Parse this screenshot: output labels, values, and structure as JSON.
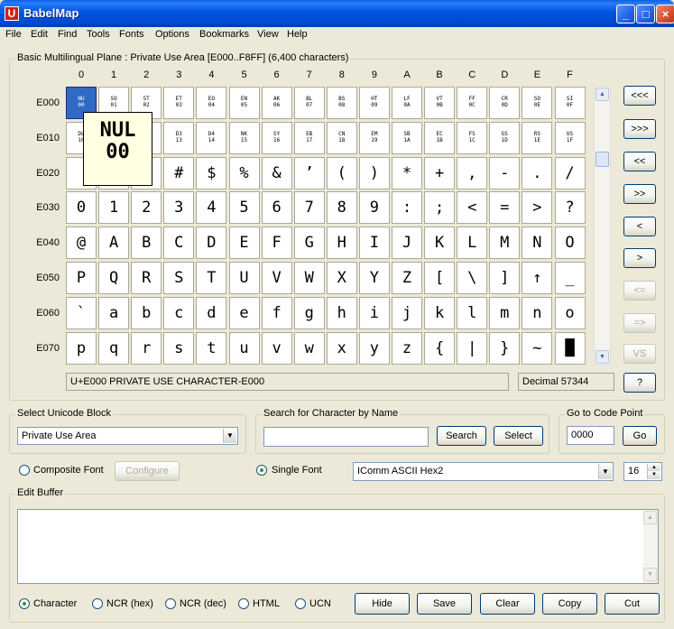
{
  "window": {
    "title": "BabelMap",
    "app_icon": "U"
  },
  "menu": [
    "File",
    "Edit",
    "Find",
    "Tools",
    "Fonts",
    "Options",
    "Bookmarks",
    "View",
    "Help"
  ],
  "grid": {
    "heading": "Basic Multilingual Plane : Private Use Area [E000..F8FF] (6,400 characters)",
    "columns": [
      "0",
      "1",
      "2",
      "3",
      "4",
      "5",
      "6",
      "7",
      "8",
      "9",
      "A",
      "B",
      "C",
      "D",
      "E",
      "F"
    ],
    "rows": [
      {
        "label": "E000",
        "small": true,
        "cells": [
          [
            "NU",
            "00"
          ],
          [
            "SO",
            "01"
          ],
          [
            "ST",
            "02"
          ],
          [
            "ET",
            "03"
          ],
          [
            "EO",
            "04"
          ],
          [
            "EN",
            "05"
          ],
          [
            "AK",
            "06"
          ],
          [
            "BL",
            "07"
          ],
          [
            "BS",
            "08"
          ],
          [
            "HT",
            "09"
          ],
          [
            "LF",
            "0A"
          ],
          [
            "VT",
            "0B"
          ],
          [
            "FF",
            "0C"
          ],
          [
            "CR",
            "0D"
          ],
          [
            "SO",
            "0E"
          ],
          [
            "SI",
            "0F"
          ]
        ]
      },
      {
        "label": "E010",
        "small": true,
        "cells": [
          [
            "DL",
            "10"
          ],
          [
            "D1",
            "11"
          ],
          [
            "D2",
            "12"
          ],
          [
            "D3",
            "13"
          ],
          [
            "D4",
            "14"
          ],
          [
            "NK",
            "15"
          ],
          [
            "SY",
            "16"
          ],
          [
            "EB",
            "17"
          ],
          [
            "CN",
            "18"
          ],
          [
            "EM",
            "19"
          ],
          [
            "SB",
            "1A"
          ],
          [
            "EC",
            "1B"
          ],
          [
            "FS",
            "1C"
          ],
          [
            "GS",
            "1D"
          ],
          [
            "RS",
            "1E"
          ],
          [
            "US",
            "1F"
          ]
        ]
      },
      {
        "label": "E020",
        "small": false,
        "cells": [
          "",
          "!",
          "\"",
          "#",
          "$",
          "%",
          "&",
          "’",
          "(",
          ")",
          "*",
          "+",
          ",",
          "-",
          ".",
          "/"
        ]
      },
      {
        "label": "E030",
        "small": false,
        "cells": [
          "0",
          "1",
          "2",
          "3",
          "4",
          "5",
          "6",
          "7",
          "8",
          "9",
          ":",
          ";",
          "<",
          "=",
          ">",
          "?"
        ]
      },
      {
        "label": "E040",
        "small": false,
        "cells": [
          "@",
          "A",
          "B",
          "C",
          "D",
          "E",
          "F",
          "G",
          "H",
          "I",
          "J",
          "K",
          "L",
          "M",
          "N",
          "O"
        ]
      },
      {
        "label": "E050",
        "small": false,
        "cells": [
          "P",
          "Q",
          "R",
          "S",
          "T",
          "U",
          "V",
          "W",
          "X",
          "Y",
          "Z",
          "[",
          "\\",
          "]",
          "↑",
          "_"
        ]
      },
      {
        "label": "E060",
        "small": false,
        "cells": [
          "`",
          "a",
          "b",
          "c",
          "d",
          "e",
          "f",
          "g",
          "h",
          "i",
          "j",
          "k",
          "l",
          "m",
          "n",
          "o"
        ]
      },
      {
        "label": "E070",
        "small": false,
        "cells": [
          "p",
          "q",
          "r",
          "s",
          "t",
          "u",
          "v",
          "w",
          "x",
          "y",
          "z",
          "{",
          "|",
          "}",
          "~",
          "█"
        ]
      }
    ],
    "tooltip": {
      "line1": "NUL",
      "line2": "00"
    },
    "status_name": "U+E000 PRIVATE USE CHARACTER-E000",
    "status_decimal": "Decimal 57344",
    "nav_buttons": [
      "<<<",
      ">>>",
      "<<",
      ">>",
      "<",
      ">",
      "<=",
      "=>",
      "VS"
    ],
    "help_button": "?"
  },
  "block": {
    "label": "Select Unicode Block",
    "value": "Private Use Area"
  },
  "search": {
    "label": "Search for Character by Name",
    "value": "",
    "search_button": "Search",
    "select_button": "Select"
  },
  "goto": {
    "label": "Go to Code Point",
    "value": "0000",
    "button": "Go"
  },
  "font": {
    "composite_label": "Composite Font",
    "configure_button": "Configure",
    "single_label": "Single Font",
    "font_name": "IComm ASCII Hex2",
    "size": "16"
  },
  "edit_buffer": {
    "label": "Edit Buffer",
    "content": ""
  },
  "copy_mode": [
    "Character",
    "NCR (hex)",
    "NCR (dec)",
    "HTML",
    "UCN"
  ],
  "actions": [
    "Hide",
    "Save",
    "Clear",
    "Copy",
    "Cut"
  ]
}
